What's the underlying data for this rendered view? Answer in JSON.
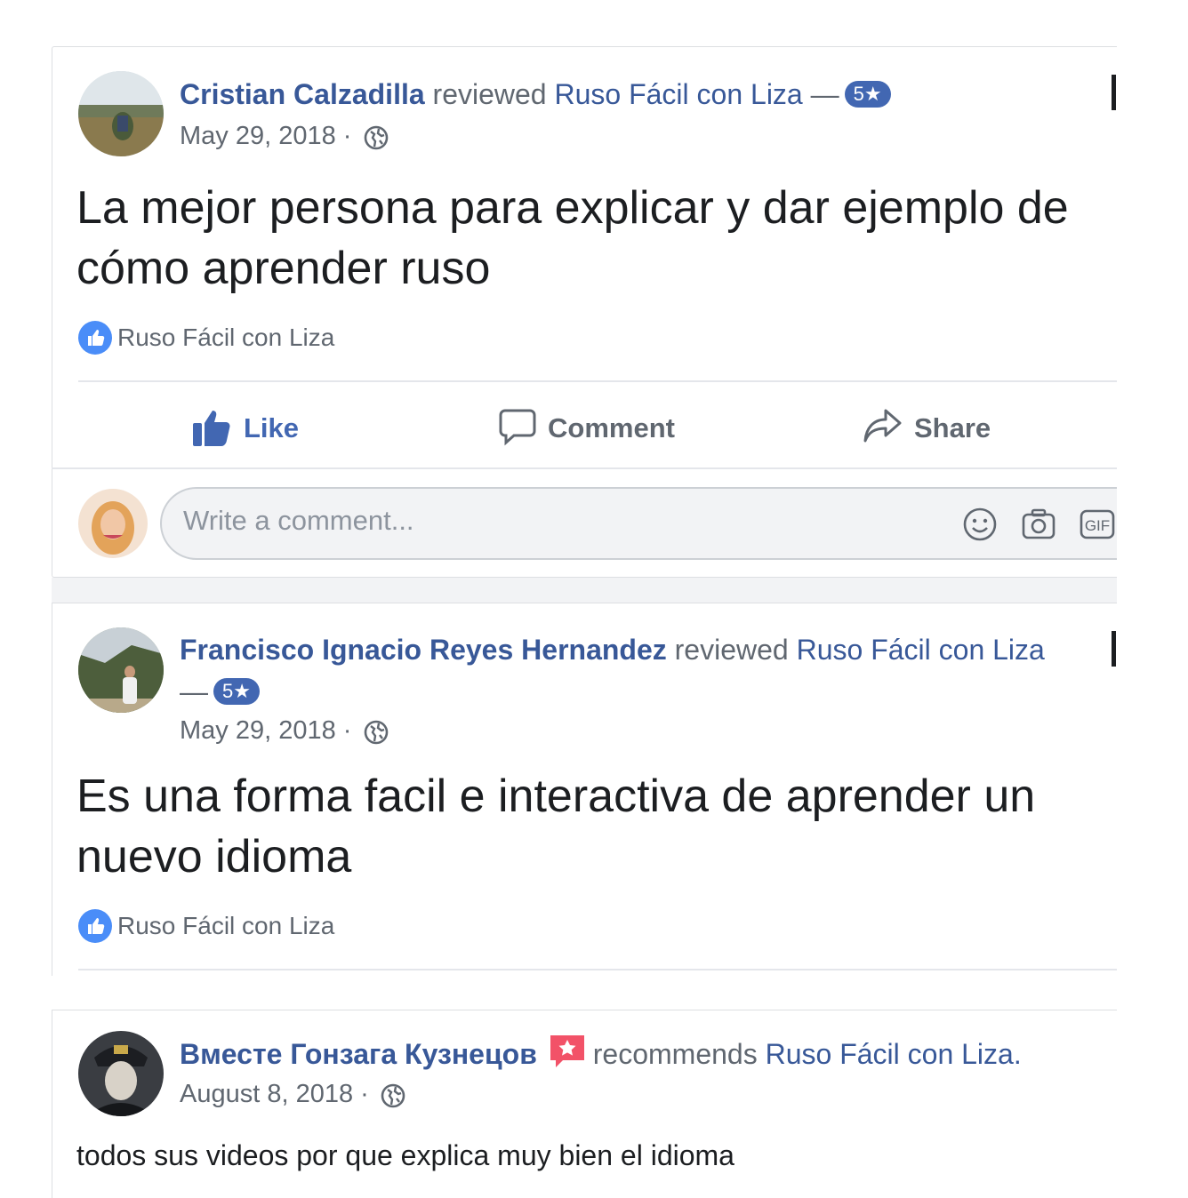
{
  "colors": {
    "link": "#385898",
    "badge": "#4267b2",
    "muted": "#606770",
    "text": "#1c1e21",
    "like_blue": "#4267b2"
  },
  "reviews": [
    {
      "author": "Cristian Calzadilla",
      "action": "reviewed",
      "page": "Ruso Fácil con Liza",
      "dash": "—",
      "rating": "5★",
      "date": "May 29, 2018 ·",
      "text": "La mejor persona para explicar y dar ejemplo de cómo aprender ruso",
      "liked_by": "Ruso Fácil con Liza"
    },
    {
      "author": "Francisco Ignacio Reyes Hernandez",
      "action": "reviewed",
      "page": "Ruso Fácil con Liza",
      "dash": "—",
      "rating": "5★",
      "date": "May 29, 2018 ·",
      "text": "Es una forma facil e interactiva de aprender un nuevo idioma",
      "liked_by": "Ruso Fácil con Liza"
    },
    {
      "author": "Вместе Гонзага Кузнецов",
      "action": "recommends",
      "page": "Ruso Fácil con Liza.",
      "date": "August 8, 2018 ·",
      "text": "todos sus videos por que explica muy bien el idioma"
    }
  ],
  "actions": {
    "like": "Like",
    "comment": "Comment",
    "share": "Share"
  },
  "comment": {
    "placeholder": "Write a comment..."
  },
  "icons": {
    "globe": "globe-icon",
    "like": "thumbs-up-icon",
    "comment": "speech-bubble-icon",
    "share": "share-arrow-icon",
    "emoji": "smiley-icon",
    "camera": "camera-icon",
    "gif": "gif-icon",
    "recommend": "recommend-flag-icon"
  }
}
